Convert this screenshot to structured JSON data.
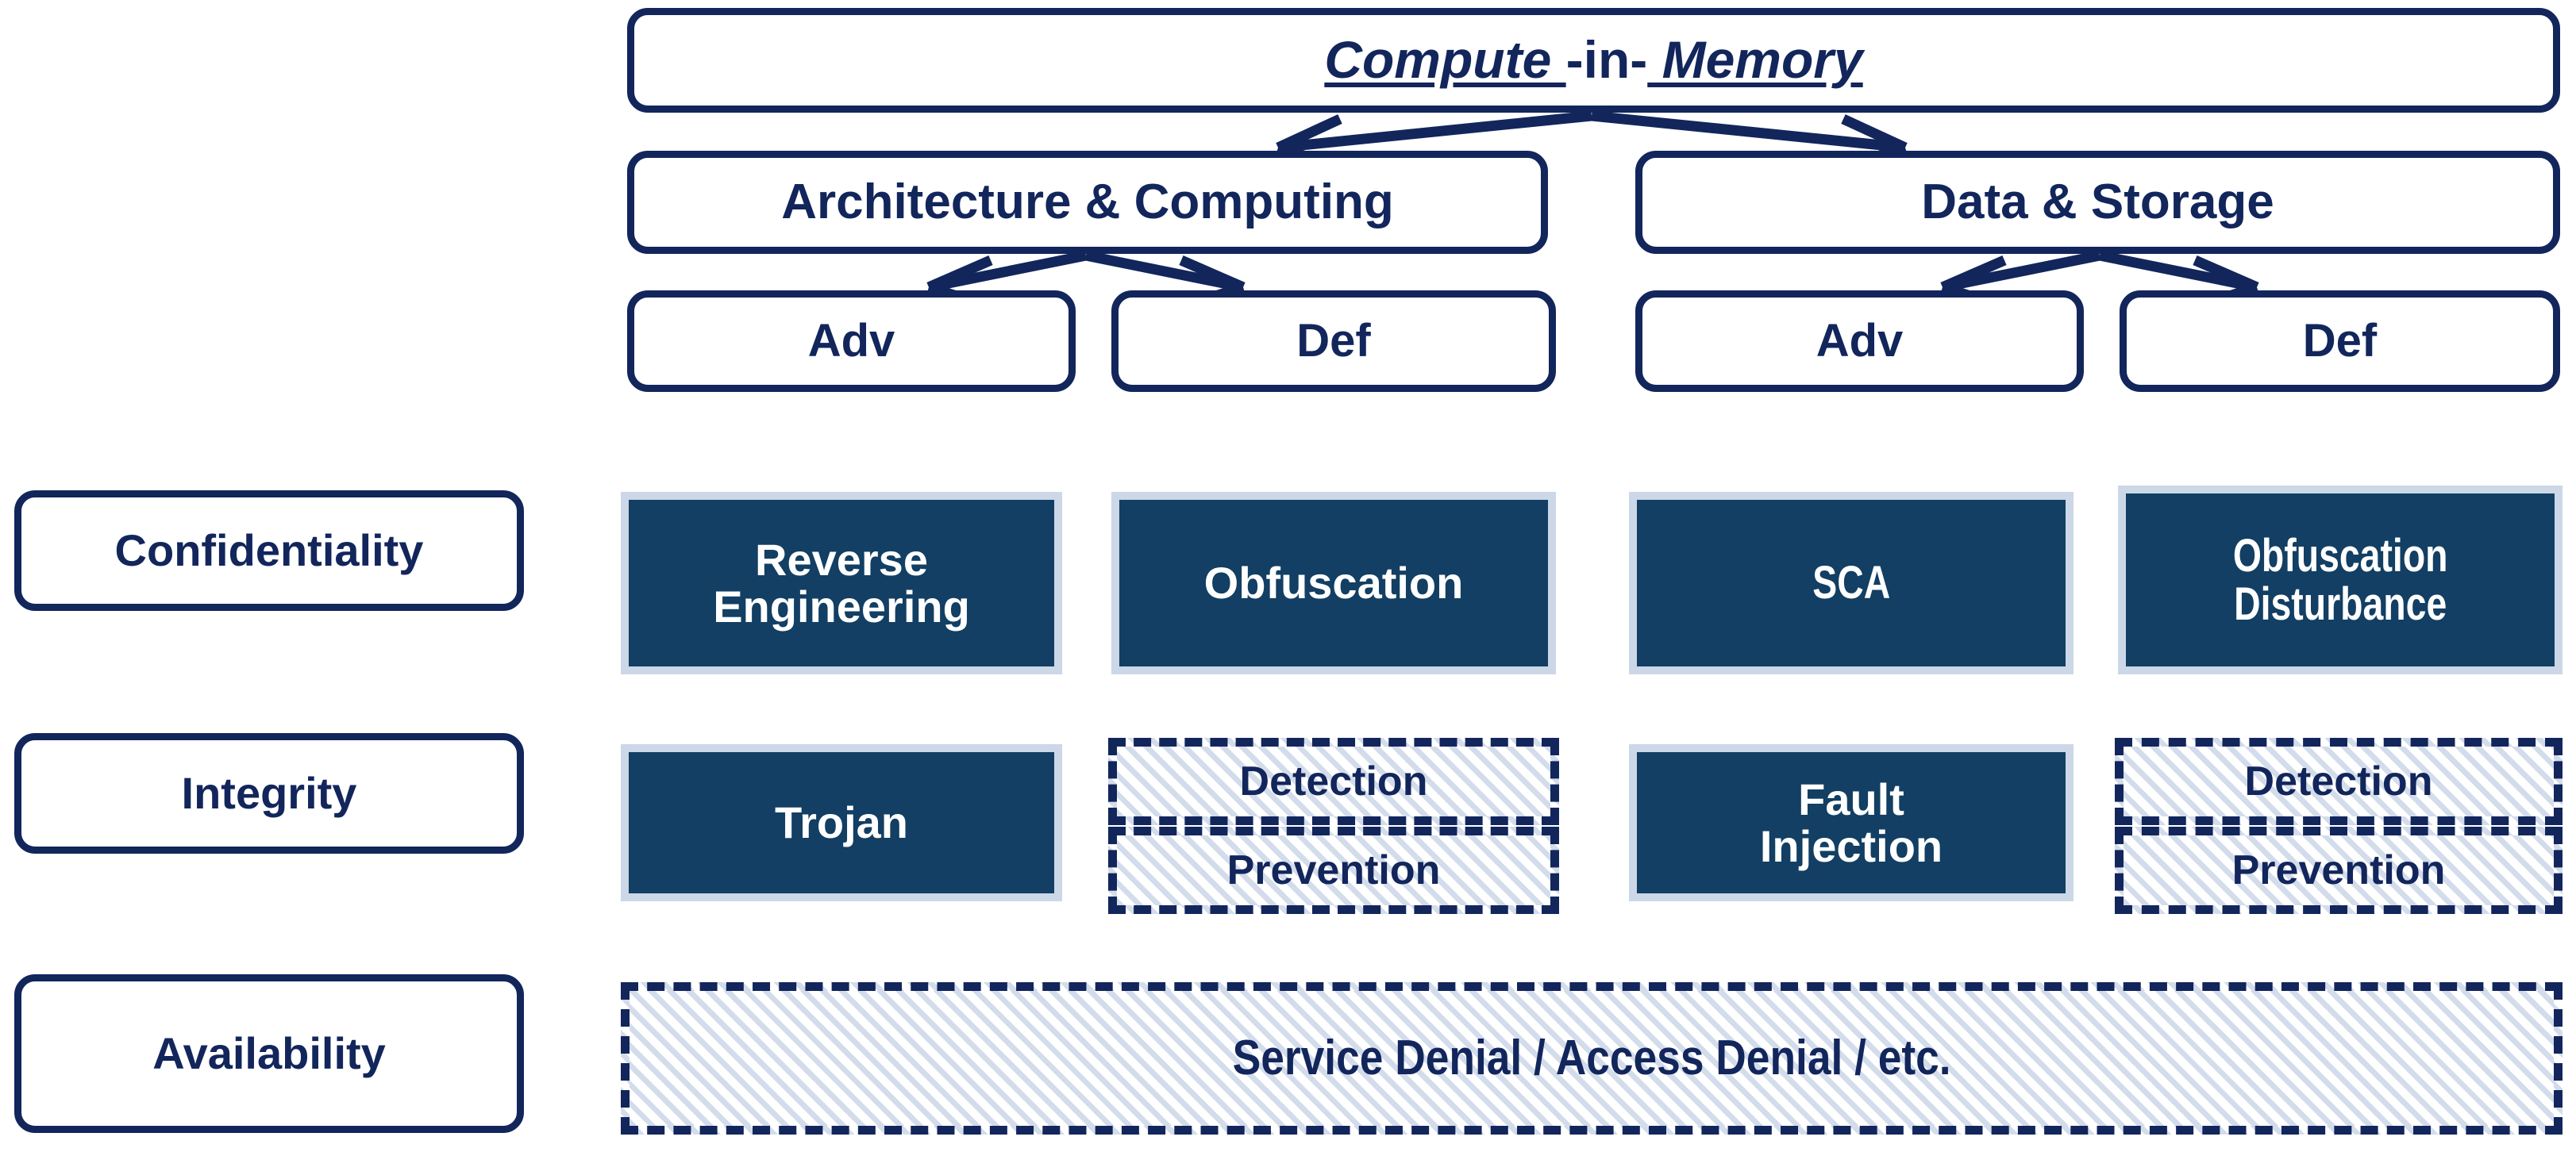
{
  "diagram": {
    "title_box": {
      "part1": "Compute ",
      "part2": "-in-",
      "part3": " Memory"
    },
    "level2": [
      {
        "label": "Architecture & Computing"
      },
      {
        "label": "Data & Storage"
      }
    ],
    "level3": [
      {
        "label": "Adv"
      },
      {
        "label": "Def"
      },
      {
        "label": "Adv"
      },
      {
        "label": "Def"
      }
    ],
    "row_labels": [
      {
        "label": "Confidentiality"
      },
      {
        "label": "Integrity"
      },
      {
        "label": "Availability"
      }
    ],
    "confidentiality_cells": [
      {
        "line1": "Reverse",
        "line2": "Engineering",
        "style": "filled"
      },
      {
        "line1": "Obfuscation",
        "line2": "",
        "style": "filled"
      },
      {
        "line1": "SCA",
        "line2": "",
        "style": "filled"
      },
      {
        "line1": "Obfuscation",
        "line2": "Disturbance",
        "style": "filled"
      }
    ],
    "integrity_cells": [
      {
        "line1": "Trojan",
        "line2": "",
        "style": "filled"
      },
      {
        "line1": "Detection",
        "line2": "Prevention",
        "style": "dashed-split"
      },
      {
        "line1": "Fault",
        "line2": "Injection",
        "style": "filled"
      },
      {
        "line1": "Detection",
        "line2": "Prevention",
        "style": "dashed-split"
      }
    ],
    "availability_cell": {
      "label": "Service Denial / Access Denial / etc.",
      "style": "dashed-hatched"
    },
    "colors": {
      "outline": "#12265c",
      "fill_dark": "#123f63",
      "fill_border_light": "#ccd7e8",
      "hatch": "#d3dceb",
      "text_light": "#ffffff",
      "background": "#ffffff"
    }
  }
}
